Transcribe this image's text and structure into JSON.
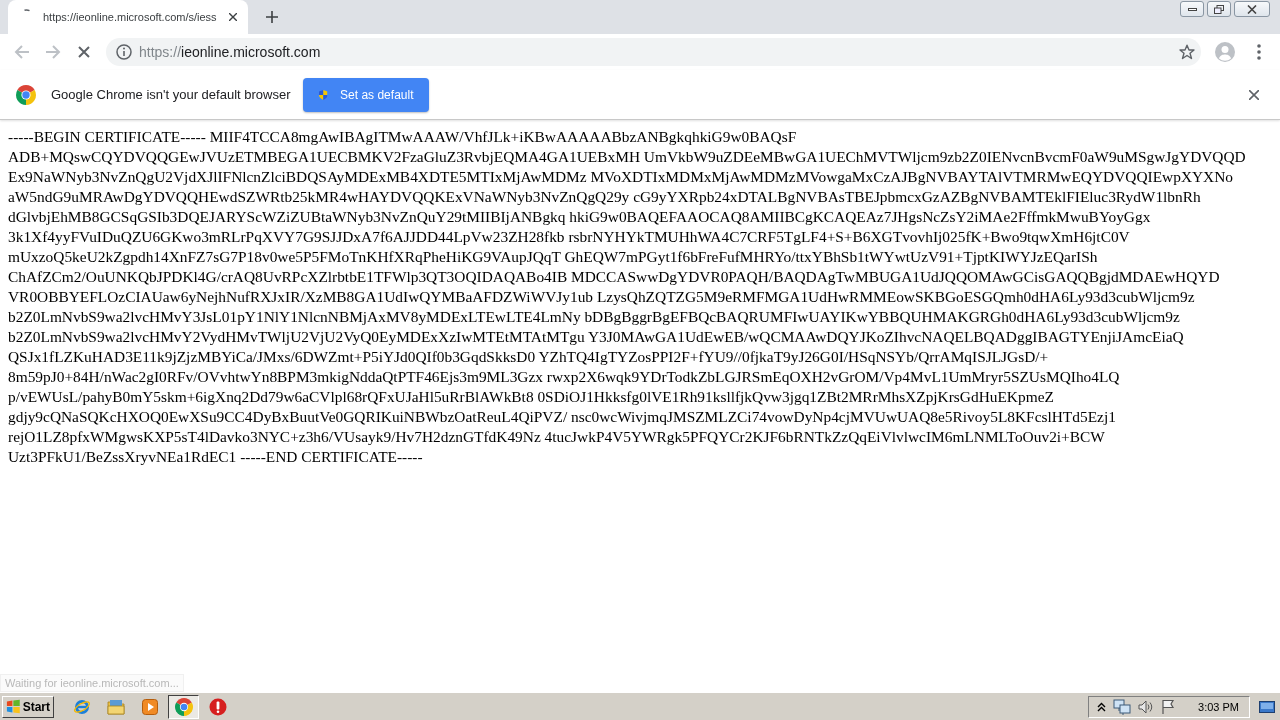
{
  "tabs": [
    {
      "title": "https://ieonline.microsoft.com/s/iess",
      "selected": true,
      "loading": true
    }
  ],
  "toolbar": {
    "loading": true,
    "url_scheme": "https://",
    "url_host": "ieonline.microsoft.com"
  },
  "infobar": {
    "message": "Google Chrome isn't your default browser",
    "button": "Set as default"
  },
  "page": {
    "text": "-----BEGIN CERTIFICATE----- MIIF4TCCA8mgAwIBAgITMwAAAW/VhfJLk+iKBwAAAAABbzANBgkqhkiG9w0BAQsF ADB+MQswCQYDVQQGEwJVUzETMBEGA1UECBMKV2FzaGluZ3RvbjEQMA4GA1UEBxMH UmVkbW9uZDEeMBwGA1UEChMVTWljcm9zb2Z0IENvcnBvcmF0aW9uMSgwJgYDVQQD Ex9NaWNyb3NvZnQgU2VjdXJlIFNlcnZlciBDQSAyMDExMB4XDTE5MTIxMjAwMDMz MVoXDTIxMDMxMjAwMDMzMVowgaMxCzAJBgNVBAYTAlVTMRMwEQYDVQQIEwpXYXNo aW5ndG9uMRAwDgYDVQQHEwdSZWRtb25kMR4wHAYDVQQKExVNaWNyb3NvZnQgQ29y cG9yYXRpb24xDTALBgNVBAsTBEJpbmcxGzAZBgNVBAMTEklFIEluc3RydW1lbnRh dGlvbjEhMB8GCSqGSIb3DQEJARYScWZiZUBtaWNyb3NvZnQuY29tMIIBIjANBgkq hkiG9w0BAQEFAAOCAQ8AMIIBCgKCAQEAz7JHgsNcZsY2iMAe2FffmkMwuBYoyGgx 3k1Xf4yyFVuIDuQZU6GKwo3mRLrPqXVY7G9SJJDxA7f6AJJDD44LpVw23ZH28fkb rsbrNYHYkTMUHhWA4C7CRF5TgLF4+S+B6XGTvovhIj025fK+Bwo9tqwXmH6jtC0V mUxzoQ5keU2kZgpdh14XnFZ7sG7P18v0we5P5FMoTnKHfXRqPheHiKG9VAupJQqT GhEQW7mPGyt1f6bFreFufMHRYo/ttxYBhSb1tWYwtUzV91+TjptKIWYJzEQarISh ChAfZCm2/OuUNKQbJPDKl4G/crAQ8UvRPcXZlrbtbE1TFWlp3QT3OQIDAQABo4IB MDCCASwwDgYDVR0PAQH/BAQDAgTwMBUGA1UdJQQOMAwGCisGAQQBgjdMDAEwHQYD VR0OBBYEFLOzCIAUaw6yNejhNufRXJxIR/XzMB8GA1UdIwQYMBaAFDZWiWVJy1ub LzysQhZQTZG5M9eRMFMGA1UdHwRMMEowSKBGoESGQmh0dHA6Ly93d3cubWljcm9z b2Z0LmNvbS9wa2lvcHMvY3JsL01pY1NlY1NlcnNBMjAxMV8yMDExLTEwLTE4LmNy bDBgBggrBgEFBQcBAQRUMFIwUAYIKwYBBQUHMAKGRGh0dHA6Ly93d3cubWljcm9z b2Z0LmNvbS9wa2lvcHMvY2VydHMvTWljU2VjU2VyQ0EyMDExXzIwMTEtMTAtMTgu Y3J0MAwGA1UdEwEB/wQCMAAwDQYJKoZIhvcNAQELBQADggIBAGTYEnjiJAmcEiaQ QSJx1fLZKuHAD3E11k9jZjzMBYiCa/JMxs/6DWZmt+P5iYJd0QIf0b3GqdSkksD0 YZhTQ4IgTYZosPPI2F+fYU9//0fjkaT9yJ26G0I/HSqNSYb/QrrAMqISJLJGsD/+ 8m59pJ0+84H/nWac2gI0RFv/OVvhtwYn8BPM3mkigNddaQtPTF46Ejs3m9ML3Gzx rwxp2X6wqk9YDrTodkZbLGJRSmEqOXH2vGrOM/Vp4MvL1UmMryr5SZUsMQIho4LQ p/vEWUsL/pahyB0mY5skm+6igXnq2Dd79w6aCVlpl68rQFxUJaHl5uRrBlAWkBt8 0SDiOJ1Hkksfg0lVE1Rh91ksllfjkQvw3jgq1ZBt2MRrMhsXZpjKrsGdHuEKpmeZ gdjy9cQNaSQKcHXOQ0EwXSu9CC4DyBxBuutVe0GQRIKuiNBWbzOatReuL4QiPVZ/ nsc0wcWivjmqJMSZMLZCi74vowDyNp4cjMVUwUAQ8e5Rivoy5L8KFcslHTd5Ezj1 rejO1LZ8pfxWMgwsKXP5sT4lDavko3NYC+z3h6/VUsayk9/Hv7H2dznGTfdK49Nz 4tucJwkP4V5YWRgk5PFQYCr2KJF6bRNTkZzQqEiVlvlwcIM6mLNMLToOuv2i+BCW Uzt3PFkU1/BeZssXryvNEa1RdEC1 -----END CERTIFICATE-----"
  },
  "status_bubble": "Waiting for ieonline.microsoft.com...",
  "taskbar": {
    "start": "Start",
    "apps": [
      {
        "kind": "ie",
        "selected": false
      },
      {
        "kind": "folder",
        "selected": false
      },
      {
        "kind": "media",
        "selected": false
      },
      {
        "kind": "chrome",
        "selected": true
      },
      {
        "kind": "alert",
        "selected": false
      }
    ],
    "clock": "3:03 PM"
  }
}
